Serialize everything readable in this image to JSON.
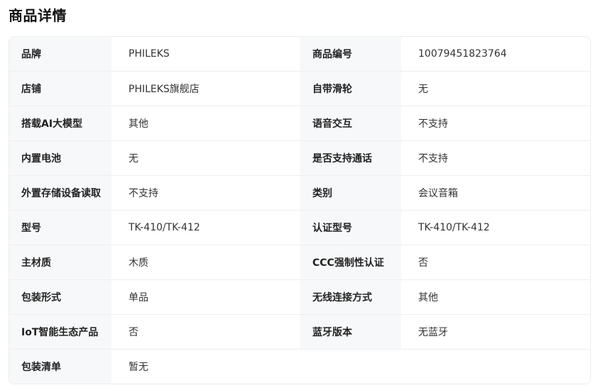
{
  "page_title": "商品详情",
  "rows": [
    [
      {
        "label": "品牌",
        "value": "PHILEKS"
      },
      {
        "label": "商品编号",
        "value": "10079451823764"
      }
    ],
    [
      {
        "label": "店铺",
        "value": "PHILEKS旗舰店"
      },
      {
        "label": "自带滑轮",
        "value": "无"
      }
    ],
    [
      {
        "label": "搭载AI大模型",
        "value": "其他"
      },
      {
        "label": "语音交互",
        "value": "不支持"
      }
    ],
    [
      {
        "label": "内置电池",
        "value": "无"
      },
      {
        "label": "是否支持通话",
        "value": "不支持"
      }
    ],
    [
      {
        "label": "外置存储设备读取",
        "value": "不支持"
      },
      {
        "label": "类别",
        "value": "会议音箱"
      }
    ],
    [
      {
        "label": "型号",
        "value": "TK-410/TK-412"
      },
      {
        "label": "认证型号",
        "value": "TK-410/TK-412"
      }
    ],
    [
      {
        "label": "主材质",
        "value": "木质"
      },
      {
        "label": "CCC强制性认证",
        "value": "否"
      }
    ],
    [
      {
        "label": "包装形式",
        "value": "单品"
      },
      {
        "label": "无线连接方式",
        "value": "其他"
      }
    ],
    [
      {
        "label": "IoT智能生态产品",
        "value": "否"
      },
      {
        "label": "蓝牙版本",
        "value": "无蓝牙"
      }
    ],
    [
      {
        "label": "包装清单",
        "value": "暂无"
      }
    ]
  ]
}
